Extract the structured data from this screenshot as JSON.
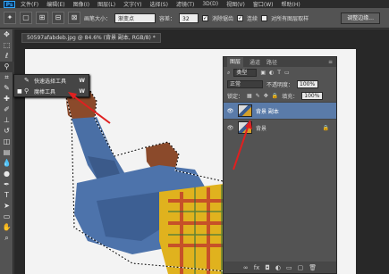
{
  "app": {
    "logo": "Ps"
  },
  "menu": [
    "文件(F)",
    "编辑(E)",
    "图像(I)",
    "图层(L)",
    "文字(Y)",
    "选择(S)",
    "滤镜(T)",
    "3D(D)",
    "视图(V)",
    "窗口(W)",
    "帮助(H)"
  ],
  "options": {
    "brush_size_label": "画笔大小：",
    "brush_size_value": "32",
    "mode_value": "渐变点",
    "hardness_label": "容差：",
    "hardness_value": "32",
    "antialias_label": "消除锯齿",
    "contiguous_label": "连续",
    "all_layers_label": "对所有图层取样",
    "refine_button": "调整边缘..."
  },
  "document": {
    "tab_title": "50597afabdeb.jpg @ 84.6% (背景 副本, RGB/8) *"
  },
  "flyout": {
    "items": [
      {
        "label": "快速选择工具",
        "key": "W",
        "selected": false
      },
      {
        "label": "魔棒工具",
        "key": "W",
        "selected": true
      }
    ]
  },
  "layers_panel": {
    "tabs": [
      "图层",
      "通道",
      "路径"
    ],
    "kind_label": "类型",
    "blend_mode": "正常",
    "opacity_label": "不透明度：",
    "opacity_value": "100%",
    "lock_label": "锁定：",
    "fill_label": "填充：",
    "fill_value": "100%",
    "layers": [
      {
        "name": "背景 副本",
        "selected": true
      },
      {
        "name": "背景",
        "selected": false
      }
    ]
  },
  "colors": {
    "accent_arrow": "#e02020",
    "selection_highlight": "#5a7ba9"
  }
}
